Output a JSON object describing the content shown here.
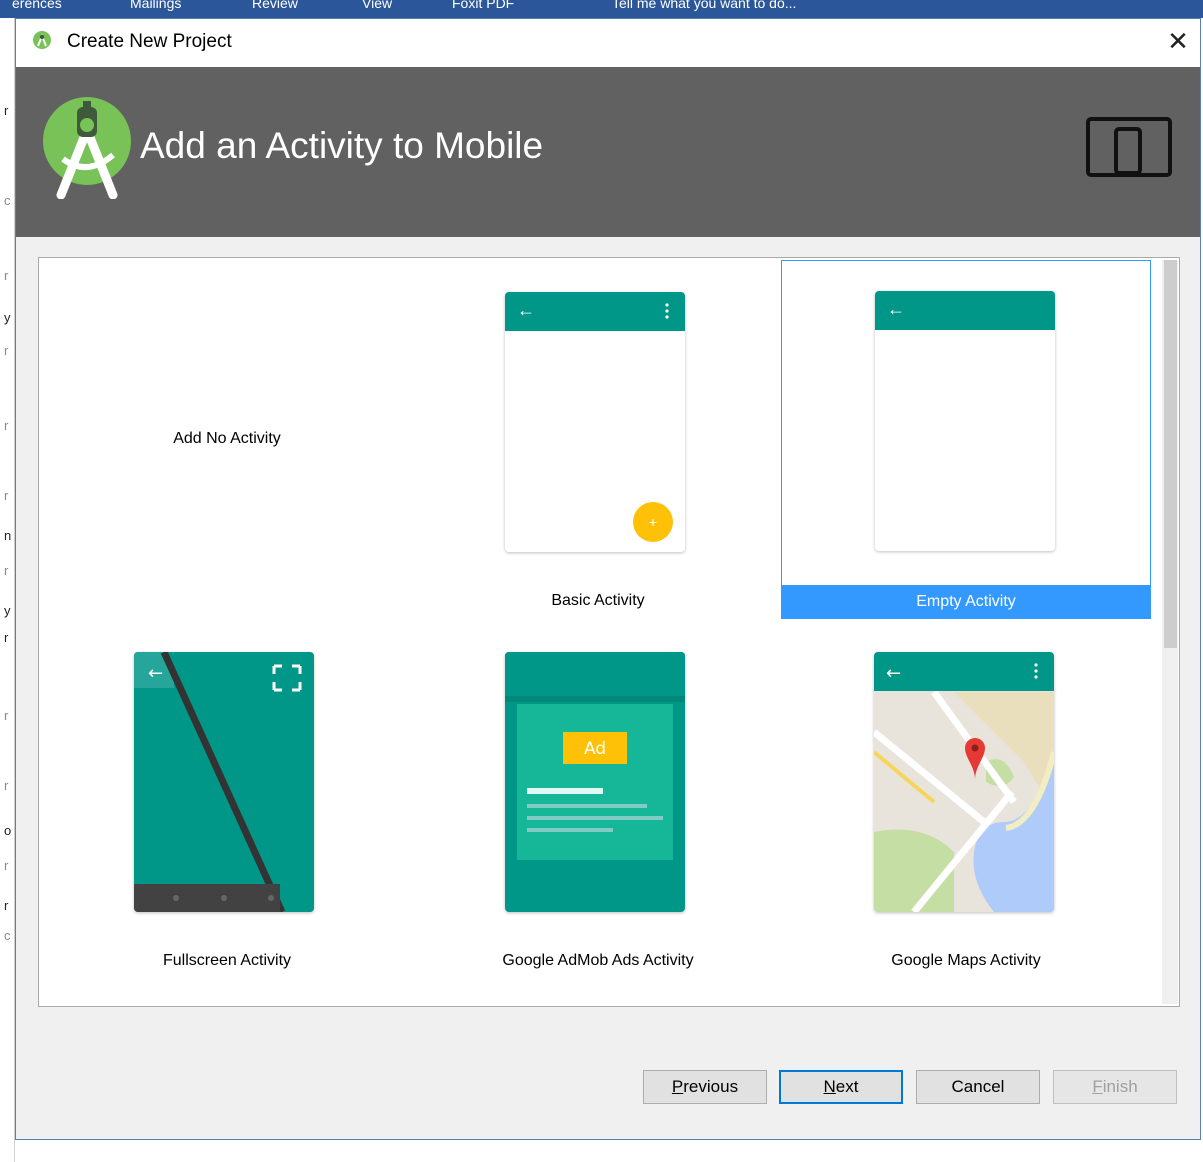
{
  "background_app": {
    "ribbon_items": [
      "erences",
      "Mailings",
      "Review",
      "View",
      "Foxit PDF",
      "Tell me what you want to do..."
    ],
    "accent": "#2b579a"
  },
  "dialog": {
    "title": "Create New Project",
    "close_icon": "close-icon",
    "banner": {
      "title": "Add an Activity to Mobile",
      "logo_icon": "android-studio-logo-icon",
      "device_icon": "phone-tablet-icon",
      "background": "#616161"
    },
    "templates": [
      {
        "label": "Add No Activity",
        "preview": "none",
        "selected": false
      },
      {
        "label": "Basic Activity",
        "preview": "basic",
        "selected": false
      },
      {
        "label": "Empty Activity",
        "preview": "empty",
        "selected": true
      },
      {
        "label": "Fullscreen Activity",
        "preview": "fullscreen",
        "selected": false
      },
      {
        "label": "Google AdMob Ads Activity",
        "preview": "admob",
        "selected": false
      },
      {
        "label": "Google Maps Activity",
        "preview": "maps",
        "selected": false
      }
    ],
    "admob_badge": "Ad",
    "buttons": {
      "previous": {
        "mnemonic": "P",
        "rest": "revious",
        "enabled": true
      },
      "next": {
        "mnemonic": "N",
        "rest": "ext",
        "enabled": true
      },
      "cancel": {
        "label": "Cancel",
        "enabled": true
      },
      "finish": {
        "mnemonic": "F",
        "rest": "inish",
        "enabled": false
      }
    },
    "colors": {
      "teal": "#009688",
      "selection": "#3399ff",
      "fab": "#ffc107"
    }
  }
}
